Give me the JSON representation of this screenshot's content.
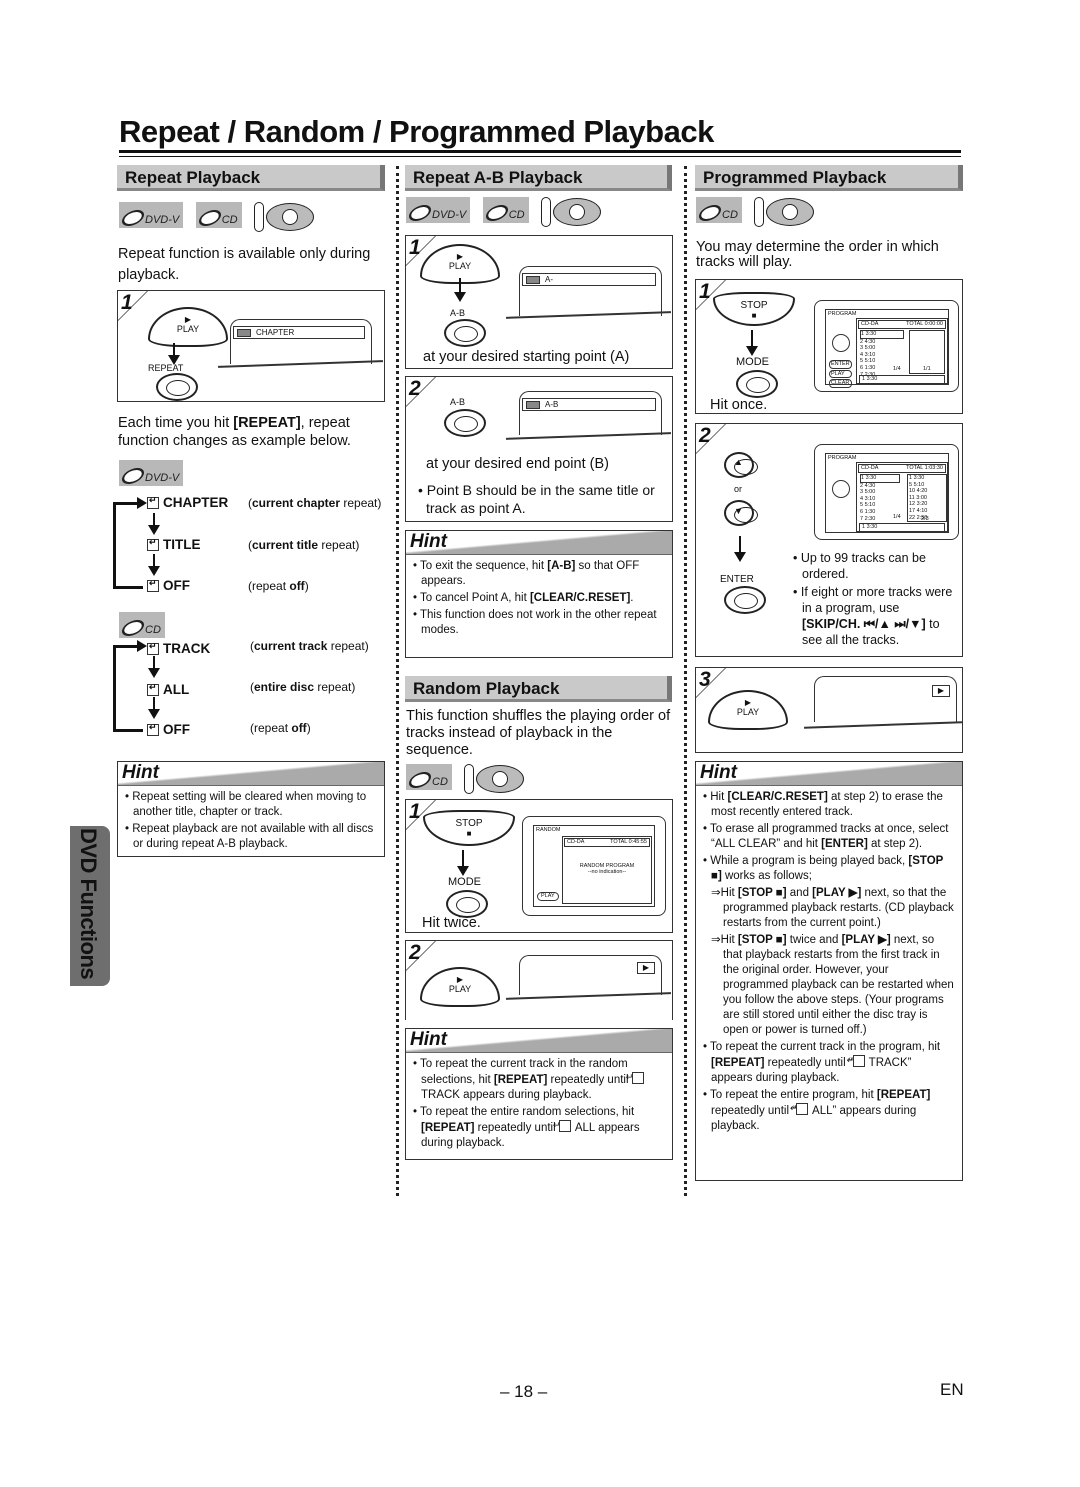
{
  "page": {
    "title": "Repeat / Random / Programmed Playback",
    "side_tab": "DVD Functions",
    "page_number": "– 18 –",
    "language": "EN"
  },
  "badges": {
    "dvd": "DVD-V",
    "cd": "CD",
    "remote": "DVD"
  },
  "repeat": {
    "heading": "Repeat Playback",
    "intro": "Repeat function is available only during playback.",
    "step1": {
      "num": "1",
      "play": "PLAY",
      "repeat": "REPEAT",
      "osd": "CHAPTER"
    },
    "explain_pre": "Each time you hit ",
    "explain_key": "[REPEAT]",
    "explain_post": ", repeat function changes as example below.",
    "dvd_cycle": [
      {
        "mode": "CHAPTER",
        "desc_bold": "current chapter",
        "desc": " repeat"
      },
      {
        "mode": "TITLE",
        "desc_bold": "current title",
        "desc": " repeat"
      },
      {
        "mode": "OFF",
        "desc_pre": "repeat ",
        "desc_bold": "off"
      }
    ],
    "cd_cycle": [
      {
        "mode": "TRACK",
        "desc_bold": "current track",
        "desc": " repeat"
      },
      {
        "mode": "ALL",
        "desc_bold": "entire disc",
        "desc": " repeat"
      },
      {
        "mode": "OFF",
        "desc_pre": "repeat ",
        "desc_bold": "off"
      }
    ],
    "hint_title": "Hint",
    "hints": [
      "Repeat setting will be cleared when moving to another title, chapter or track.",
      "Repeat playback are not available with all discs or during repeat A-B playback."
    ]
  },
  "ab": {
    "heading": "Repeat A-B Playback",
    "step1": {
      "num": "1",
      "play": "PLAY",
      "ab": "A-B",
      "osd": "A-",
      "caption": "at your desired starting point (A)"
    },
    "step2": {
      "num": "2",
      "ab": "A-B",
      "osd": "A-B",
      "caption": "at your desired end point (B)",
      "note": "Point B should be in the same title or track as point A."
    },
    "hint_title": "Hint",
    "hints": [
      {
        "pre": "To exit the sequence, hit ",
        "key": "[A-B]",
        "post": " so that OFF appears."
      },
      {
        "pre": "To cancel Point A, hit ",
        "key": "[CLEAR/C.RESET]",
        "post": "."
      },
      {
        "pre": "This function does not work in the other repeat modes.",
        "key": "",
        "post": ""
      }
    ]
  },
  "random": {
    "heading": "Random Playback",
    "intro": "This function shuffles the playing order of tracks instead of playback in the sequence.",
    "step1": {
      "num": "1",
      "stop": "STOP",
      "mode": "MODE",
      "caption": "Hit twice.",
      "screen": {
        "title": "RANDOM",
        "disc": "CD-DA",
        "total": "TOTAL 0:45:55",
        "line1": "RANDOM PROGRAM",
        "line2": "--no indication--",
        "play": "PLAY"
      }
    },
    "step2": {
      "num": "2",
      "play": "PLAY"
    },
    "hint_title": "Hint",
    "hints": [
      {
        "pre": "To repeat the current track in the random selections, hit ",
        "key": "[REPEAT]",
        "post": " repeatedly until ",
        "icon": true,
        "tail": "TRACK appears during playback."
      },
      {
        "pre": "To repeat the entire random selections, hit ",
        "key": "[REPEAT]",
        "post": " repeatedly until ",
        "icon": true,
        "tail": "ALL appears during playback."
      }
    ]
  },
  "program": {
    "heading": "Programmed Playback",
    "intro": "You may determine the order in which tracks will play.",
    "step1": {
      "num": "1",
      "stop": "STOP",
      "mode": "MODE",
      "caption": "Hit once.",
      "screen": {
        "title": "PROGRAM",
        "disc": "CD-DA",
        "total": "TOTAL 0:00:00",
        "tracks": [
          "1  3:30",
          "2  4:30",
          "3  5:00",
          "4  3:10",
          "5  5:10",
          "6  1:30",
          "7  2:30"
        ],
        "page": "1/4",
        "page2": "1/1",
        "selected": "1  3:30",
        "buttons": [
          "ENTER",
          "PLAY",
          "CLEAR"
        ]
      }
    },
    "step2": {
      "num": "2",
      "or": "or",
      "enter": "ENTER",
      "notes": [
        "Up to 99 tracks can be ordered."
      ],
      "note2_pre": "If eight or more tracks were in a program, use ",
      "note2_key": "[SKIP/CH. ⏮/▲ ⏭/▼]",
      "note2_post": " to see all the tracks.",
      "screen": {
        "title": "PROGRAM",
        "disc": "CD-DA",
        "total": "TOTAL 1:03:30",
        "tracks": [
          "1  3:30",
          "2  4:30",
          "3  5:00",
          "4  3:10",
          "5  5:10",
          "6  1:30",
          "7  2:30"
        ],
        "programmed": [
          "1    3:30",
          "5    5:10",
          "10  4:20",
          "11  3:00",
          "12  3:20",
          "17  4:10",
          "22  2:50"
        ],
        "page": "1/4",
        "page2": "2/3",
        "selected": "1  3:30"
      }
    },
    "step3": {
      "num": "3",
      "play": "PLAY"
    },
    "hint_title": "Hint",
    "hint1_pre": "Hit ",
    "hint1_key": "[CLEAR/C.RESET]",
    "hint1_post": " at step 2) to erase the most recently entered track.",
    "hint2_pre": "To erase all programmed tracks at once, select “ALL CLEAR” and hit ",
    "hint2_key": "[ENTER]",
    "hint2_post": " at step 2).",
    "hint3_pre": "While a program is being played back, ",
    "hint3_key": "[STOP ■]",
    "hint3_post": " works as follows;",
    "sub1_pre": "⇒Hit ",
    "sub1_k1": "[STOP ■]",
    "sub1_mid": " and ",
    "sub1_k2": "[PLAY ▶]",
    "sub1_post": " next, so that the programmed playback restarts. (CD playback restarts from the current point.)",
    "sub2_pre": "⇒Hit ",
    "sub2_k1": "[STOP ■]",
    "sub2_mid": " twice and ",
    "sub2_k2": "[PLAY ▶]",
    "sub2_post": " next, so that playback restarts from the first track in the original order. However, your programmed playback can be restarted when you follow the above steps. (Your programs are still stored until either the disc tray is open or power is turned off.)",
    "hint4_pre": "To repeat the current track in the program, hit ",
    "hint4_key": "[REPEAT]",
    "hint4_post": " repeatedly until “",
    "hint4_tail": "TRACK” appears during playback.",
    "hint5_pre": "To repeat the entire program, hit ",
    "hint5_key": "[REPEAT]",
    "hint5_post": " repeatedly until “",
    "hint5_tail": "ALL” appears during playback."
  }
}
